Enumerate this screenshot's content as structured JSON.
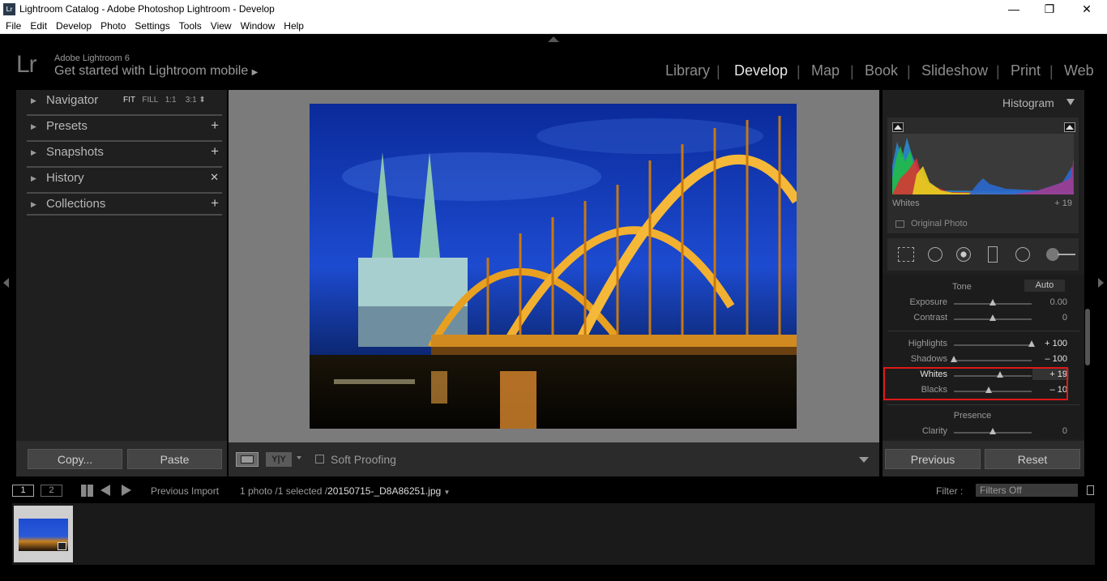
{
  "window": {
    "icon_text": "Lr",
    "title": "Lightroom Catalog - Adobe Photoshop Lightroom - Develop",
    "minimize": "—",
    "restore": "❐",
    "close": "✕"
  },
  "menu": [
    "File",
    "Edit",
    "Develop",
    "Photo",
    "Settings",
    "Tools",
    "View",
    "Window",
    "Help"
  ],
  "identity": {
    "logo": "Lr",
    "product": "Adobe Lightroom 6",
    "mobile": "Get started with Lightroom mobile",
    "mobile_arrow": "▶"
  },
  "modules": [
    "Library",
    "Develop",
    "Map",
    "Book",
    "Slideshow",
    "Print",
    "Web"
  ],
  "active_module": "Develop",
  "left_panel": {
    "items": [
      {
        "label": "Navigator",
        "action": ""
      },
      {
        "label": "Presets",
        "action": "+"
      },
      {
        "label": "Snapshots",
        "action": "+"
      },
      {
        "label": "History",
        "action": "✕"
      },
      {
        "label": "Collections",
        "action": "+"
      }
    ],
    "navigator_options": {
      "fit": "FIT",
      "fill": "FILL",
      "one": "1:1",
      "three": "3:1",
      "arrows": "⬍"
    },
    "copy_button": "Copy...",
    "paste_button": "Paste"
  },
  "toolbar": {
    "yy": "Y|Y",
    "soft_proofing": "Soft Proofing"
  },
  "right_panel": {
    "histogram_title": "Histogram",
    "histogram_readout_label": "Whites",
    "histogram_readout_value": "+ 19",
    "original_photo": "Original Photo",
    "tone_label": "Tone",
    "auto": "Auto",
    "sliders": [
      {
        "label": "Exposure",
        "value": "0.00",
        "level": 0.5
      },
      {
        "label": "Contrast",
        "value": "0",
        "level": 0.5
      },
      {
        "label": "Highlights",
        "value": "+ 100",
        "level": 1.0
      },
      {
        "label": "Shadows",
        "value": "– 100",
        "level": 0.0
      },
      {
        "label": "Whites",
        "value": "+ 19",
        "level": 0.595
      },
      {
        "label": "Blacks",
        "value": "– 10",
        "level": 0.45
      }
    ],
    "presence_label": "Presence",
    "clarity": {
      "label": "Clarity",
      "value": "0",
      "level": 0.5
    },
    "previous_button": "Previous",
    "reset_button": "Reset"
  },
  "filmstrip_bar": {
    "screen1": "1",
    "screen2": "2",
    "source": "Previous Import",
    "count": "1 photo /1 selected /",
    "filename": "20150715-_D8A86251.jpg",
    "filter_label": "Filter :",
    "filter_value": "Filters Off"
  },
  "colors": {
    "panel_bg": "#1f1f1f",
    "canvas_bg": "#7b7b7b",
    "highlight_box": "#e01818"
  }
}
